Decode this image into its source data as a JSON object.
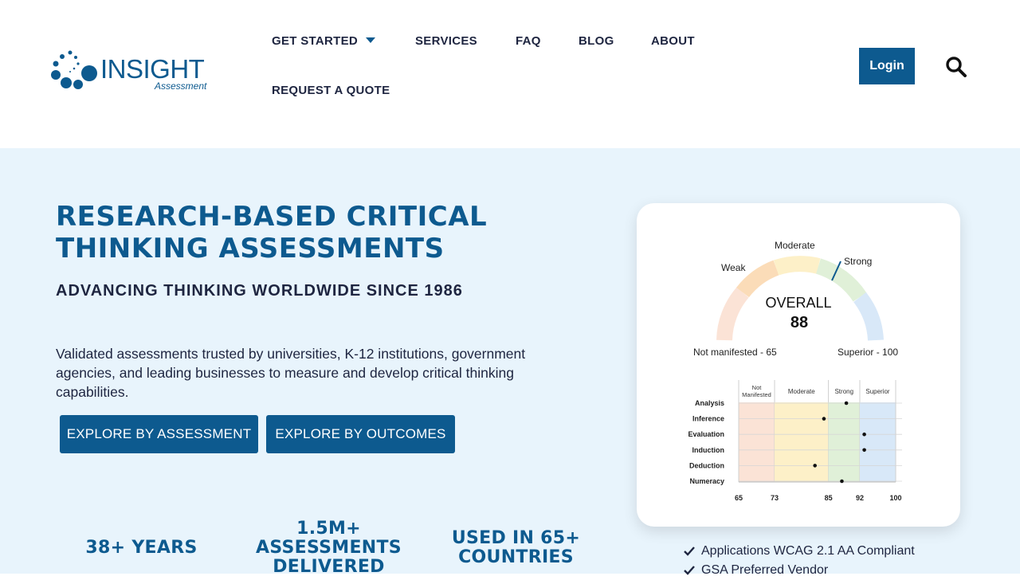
{
  "brand": {
    "logo_name": "INSIGHT",
    "logo_sub": "Assessment",
    "primary_color": "#0d5a8f",
    "hero_bg": "#e8f4fc"
  },
  "nav": {
    "get_started": "GET STARTED",
    "services": "SERVICES",
    "faq": "FAQ",
    "blog": "BLOG",
    "about": "ABOUT",
    "request_quote": "REQUEST A QUOTE",
    "login": "Login",
    "search_icon": "search-icon"
  },
  "hero": {
    "title": "RESEARCH-BASED CRITICAL THINKING ASSESSMENTS",
    "subtitle": "ADVANCING THINKING WORLDWIDE SINCE 1986",
    "description": "Validated assessments trusted by universities, K-12 institutions, government agencies, and leading businesses to measure and develop critical thinking capabilities.",
    "cta_assessment": "EXPLORE BY ASSESSMENT",
    "cta_outcomes": "EXPLORE BY OUTCOMES"
  },
  "stats": [
    {
      "label": "38+ YEARS"
    },
    {
      "label": "1.5M+ ASSESSMENTS DELIVERED"
    },
    {
      "label": "USED IN 65+ COUNTRIES"
    }
  ],
  "report": {
    "gauge": {
      "weak": "Weak",
      "moderate": "Moderate",
      "strong": "Strong",
      "overall_label": "OVERALL",
      "overall_score": "88",
      "min_label": "Not manifested - 65",
      "max_label": "Superior - 100",
      "score_value": 88,
      "range": [
        65,
        100
      ]
    },
    "chart_data": {
      "type": "scatter",
      "band_labels": [
        "Not Manifested",
        "Moderate",
        "Strong",
        "Superior"
      ],
      "band_colors": [
        "#fbe3d6",
        "#fdf0c8",
        "#e0f0d8",
        "#d8e8f8"
      ],
      "x_ticks": [
        65,
        73,
        85,
        92,
        100
      ],
      "xlim": [
        65,
        100
      ],
      "categories": [
        "Analysis",
        "Inference",
        "Evaluation",
        "Induction",
        "Deduction",
        "Numeracy"
      ],
      "values": [
        89,
        84,
        93,
        93,
        82,
        88
      ]
    }
  },
  "badges": [
    {
      "label": "Applications WCAG 2.1 AA Compliant"
    },
    {
      "label": "GSA Preferred Vendor"
    }
  ]
}
